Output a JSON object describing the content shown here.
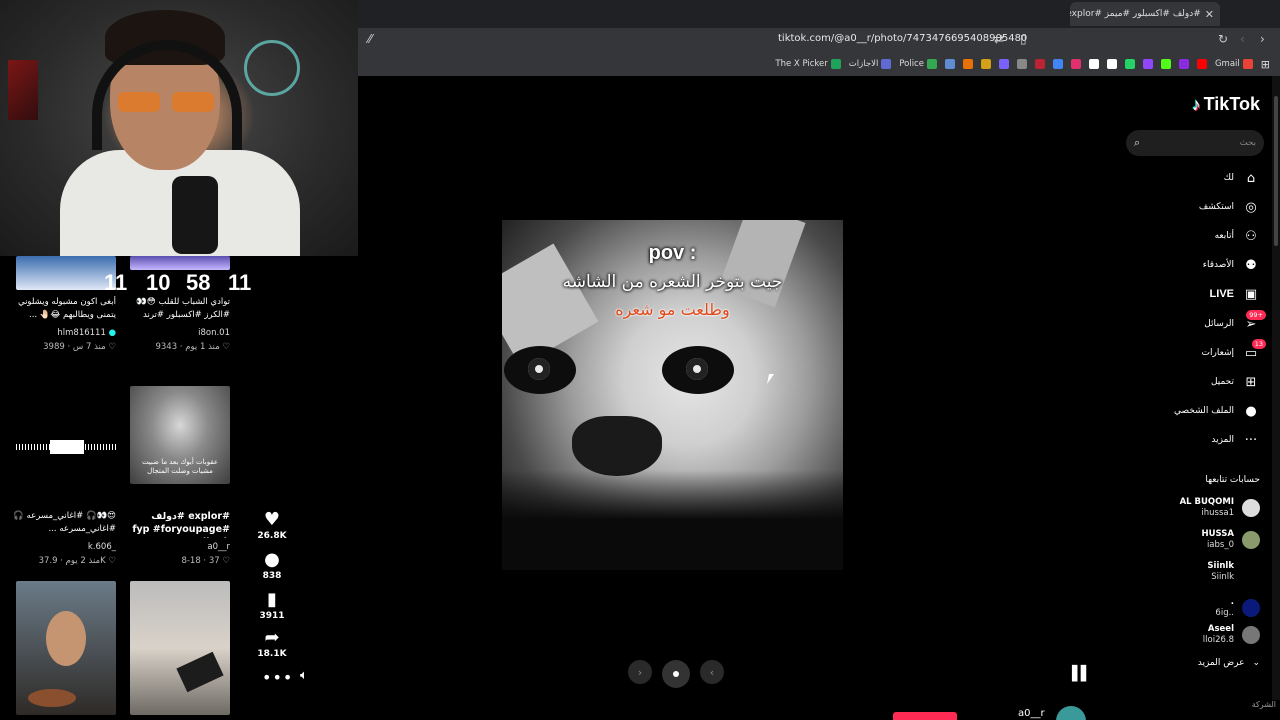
{
  "browser": {
    "tab_title": "#دولف #اكسبلور #ميمز #explor",
    "tab_close": "✕",
    "new_tab": "+",
    "url": "tiktok.com/@a0__r/photo/7473476695408905480",
    "bookmarks": [
      {
        "label": "Gmail",
        "color": "#ea4335"
      },
      {
        "label": "",
        "color": "#ff0000"
      },
      {
        "label": "",
        "color": "#8a2be2"
      },
      {
        "label": "",
        "color": "#53fc18"
      },
      {
        "label": "",
        "color": "#9146ff"
      },
      {
        "label": "",
        "color": "#25d366"
      },
      {
        "label": "",
        "color": "#ffffff"
      },
      {
        "label": "",
        "color": "#ffffff"
      },
      {
        "label": "",
        "color": "#e1306c"
      },
      {
        "label": "",
        "color": "#4285f4"
      },
      {
        "label": "",
        "color": "#b23"
      },
      {
        "label": "",
        "color": "#888"
      },
      {
        "label": "",
        "color": "#7b61ff"
      },
      {
        "label": "",
        "color": "#d4a017"
      },
      {
        "label": "",
        "color": "#e8710a"
      },
      {
        "label": "",
        "color": "#5f8dd3"
      },
      {
        "label": "Police",
        "color": "#34a853"
      },
      {
        "label": "الاجازات",
        "color": "#5f6bd3"
      },
      {
        "label": "The X Picker",
        "color": "#1fa35a"
      }
    ]
  },
  "profile_grid": {
    "top_counts": [
      "11",
      "10",
      "58",
      "11"
    ],
    "row1": [
      {
        "caption": "أبغى اكون مشبوله ويشلوني يتمنى ويطالبهم 😂🤚🏻 ...",
        "user": "hlm816111",
        "likes": "3989",
        "age": "منذ 7 س"
      },
      {
        "caption": "توادي الشباب للقلب 😳👀 #الكرز #اكسبلور #ترند",
        "user": "i8on.01",
        "likes": "9343",
        "age": "منذ 1 يوم"
      }
    ],
    "saddam_text": "عقوبات أبوك بعد ما ضبيت مشيات وضلت المتجال",
    "row2": [
      {
        "caption": "😍👀🎧 #اغاني_مسرعه 🎧 #اغاني_مسرعه ...",
        "user": "k.606_",
        "likes": "37.9K",
        "age": "منذ 2 يوم"
      },
      {
        "caption": "#explor #دولف #fyp #foryoupage #tiktok",
        "user": "a0__r",
        "likes": "37",
        "age": "8-18"
      }
    ]
  },
  "actions": {
    "likes": "26.8K",
    "comments": "838",
    "saves": "3911",
    "shares": "18.1K"
  },
  "photo": {
    "line_pov": "pov :",
    "line1": "جيت بتوخر الشعره من الشاشه",
    "line2": "وطلعت مو شعره"
  },
  "sidebar": {
    "logo": "TikTok",
    "search_placeholder": "بحث",
    "nav": [
      {
        "label": "لك",
        "icon": "home-icon"
      },
      {
        "label": "استكشف",
        "icon": "compass-icon"
      },
      {
        "label": "أتابعه",
        "icon": "user-follow-icon"
      },
      {
        "label": "الأصدقاء",
        "icon": "friends-icon"
      },
      {
        "label": "LIVE",
        "icon": "live-icon"
      },
      {
        "label": "الرسائل",
        "icon": "messages-icon",
        "badge": "99+"
      },
      {
        "label": "إشعارات",
        "icon": "inbox-icon",
        "badge": "13"
      },
      {
        "label": "تحميل",
        "icon": "upload-icon"
      },
      {
        "label": "الملف الشخصي",
        "icon": "profile-icon"
      },
      {
        "label": "المزيد",
        "icon": "more-icon"
      }
    ],
    "following_title": "حسابات تتابعها",
    "following": [
      {
        "name": "AL BUQOMI",
        "handle": "ihussa1",
        "color": "#ddd"
      },
      {
        "name": "HUSSA",
        "handle": "iabs_0",
        "color": "#8a9a6a"
      },
      {
        "name": "Siinlk",
        "handle": "Siinlk",
        "color": "#000"
      },
      {
        "name": ".",
        "handle": "6ig..",
        "color": "#0a1a7a"
      },
      {
        "name": "Aseel",
        "handle": "lloi26.8",
        "color": "#777"
      }
    ],
    "see_more": "عرض المزيد",
    "company": "الشركة"
  },
  "bottom": {
    "text": "a0__r"
  },
  "colors": {
    "accent": "#fe2c55",
    "background": "#000000",
    "chrome": "#35363a"
  }
}
